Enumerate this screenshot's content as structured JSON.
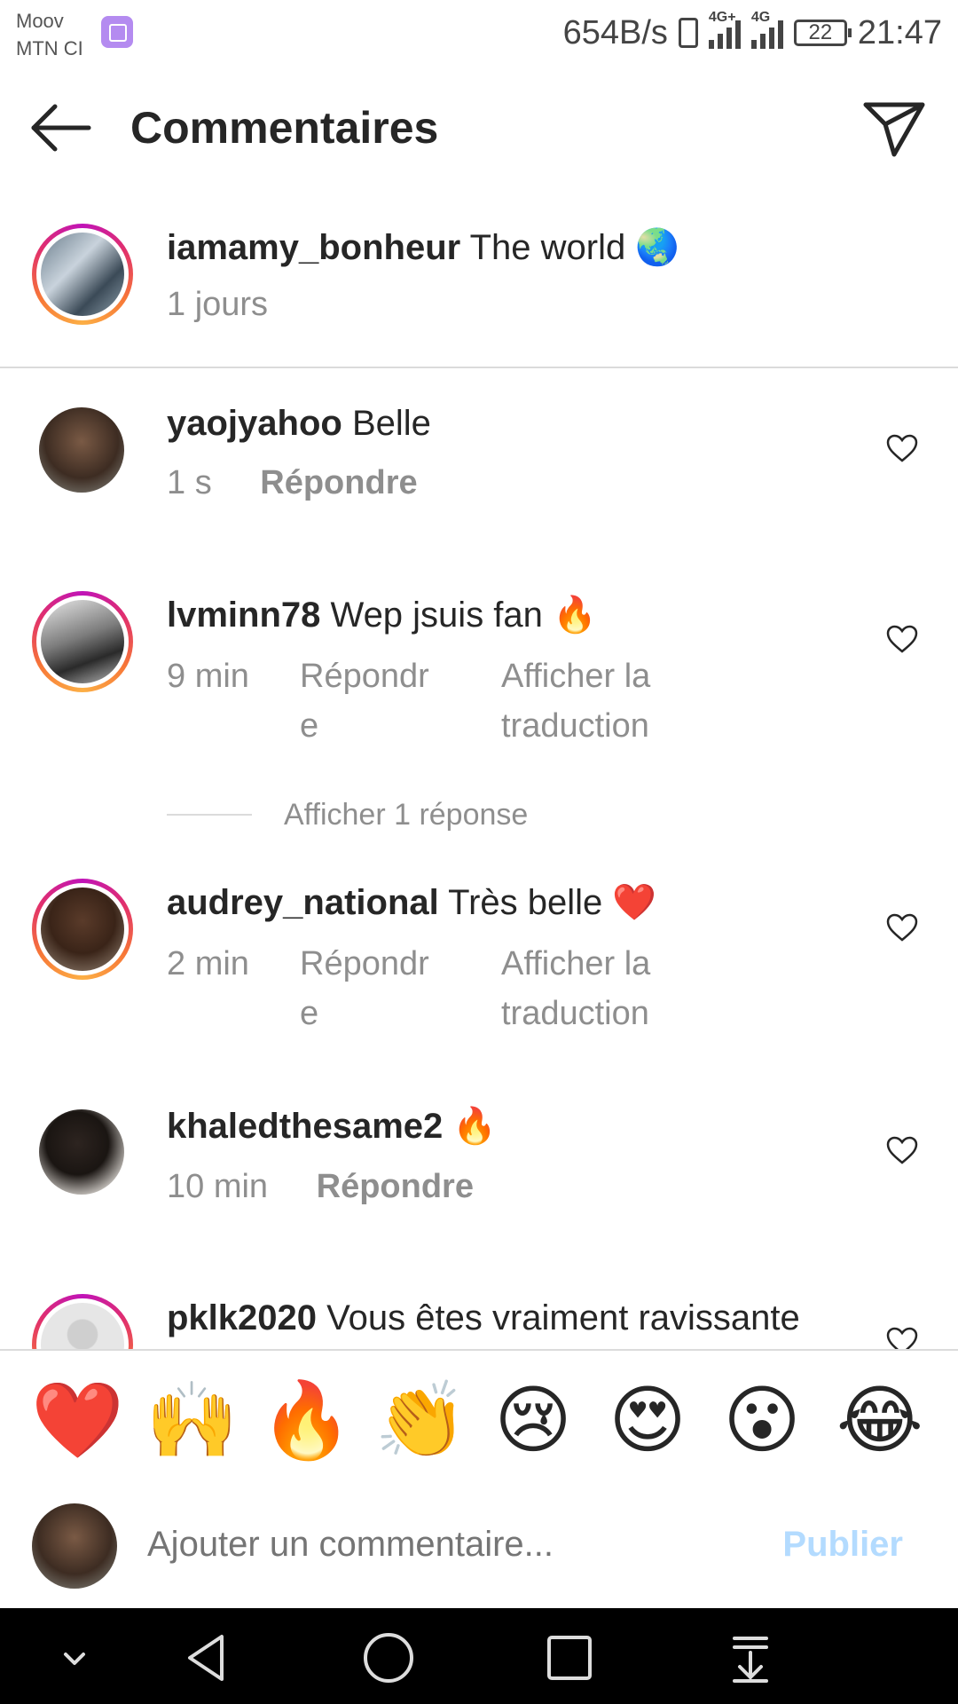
{
  "status_bar": {
    "carrier_line1": "Moov",
    "carrier_line2": "MTN CI",
    "network_speed": "654B/s",
    "signal1_label": "4G+",
    "signal2_label": "4G",
    "battery": "22",
    "time": "21:47"
  },
  "header": {
    "title": "Commentaires",
    "back_icon": "arrow-left-icon",
    "share_icon": "paper-plane-icon"
  },
  "caption": {
    "username": "iamamy_bonheur",
    "text": "The world 🌏",
    "time": "1 jours"
  },
  "comments": [
    {
      "username": "yaojyahoo",
      "text": "Belle",
      "time": "1 s",
      "reply": "Répondre",
      "translate": ""
    },
    {
      "username": "lvminn78",
      "text": "Wep jsuis fan 🔥",
      "time": "9 min",
      "reply_l1": "Répondr",
      "reply_l2": "e",
      "translate_l1": "Afficher la",
      "translate_l2": "traduction"
    },
    {
      "username": "audrey_national",
      "text": "Très belle ❤️",
      "time": "2 min",
      "reply_l1": "Répondr",
      "reply_l2": "e",
      "translate_l1": "Afficher la",
      "translate_l2": "traduction"
    },
    {
      "username": "khaledthesame2",
      "text": "🔥",
      "time": "10 min",
      "reply": "Répondre"
    },
    {
      "username": "pklk2020",
      "text": "Vous êtes vraiment ravissante"
    }
  ],
  "view_replies": "Afficher 1 réponse",
  "emoji_bar": [
    "❤️",
    "🙌",
    "🔥",
    "👏",
    "😢",
    "😍",
    "😮",
    "😂"
  ],
  "composer": {
    "placeholder": "Ajouter un commentaire...",
    "publish": "Publier"
  },
  "colors": {
    "text": "#262626",
    "secondary": "#8e8e8e",
    "divider": "#dbdbdb",
    "publish_disabled": "#b3dbff",
    "story_ring": [
      "#c013b8",
      "#e1306c",
      "#f77737",
      "#fcaf45"
    ]
  }
}
